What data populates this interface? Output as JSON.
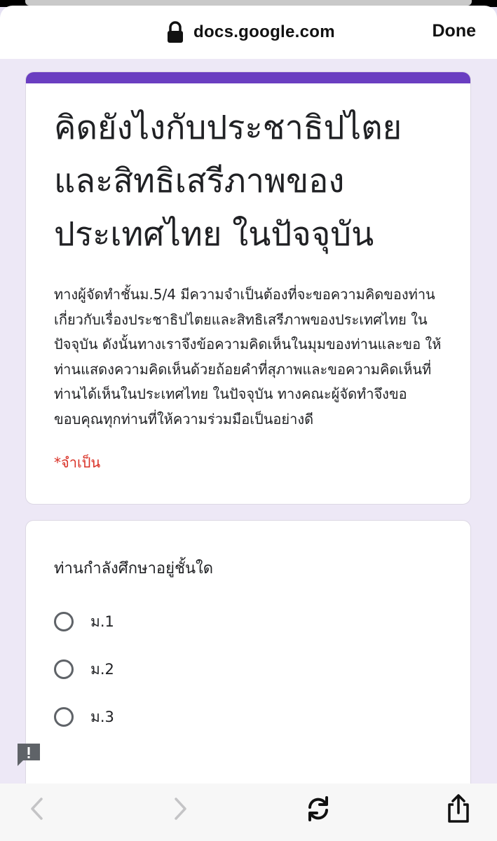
{
  "browser": {
    "url": "docs.google.com",
    "done_label": "Done",
    "secure_icon": "lock-icon"
  },
  "form": {
    "accent_color": "#6a3ec1",
    "title": "คิดยังไงกับประชาธิปไตยและสิทธิเสรีภาพของประเทศไทย ในปัจจุบัน",
    "description": "ทางผู้จัดทำชั้นม.5/4 มีความจำเป็นต้องที่จะขอความคิดของท่าน เกี่ยวกับเรื่องประชาธิปไตยและสิทธิเสรีภาพของประเทศไทย ในปัจจุบัน ดังนั้นทางเราจึงข้อความคิดเห็นในมุมของท่านและขอ ให้ท่านแสดงความคิดเห็นด้วยถ้อยคำที่สุภาพและขอความคิดเห็นที่ท่านได้เห็นในประเทศไทย ในปัจจุบัน ทางคณะผู้จัดทำจึงขอขอบคุณทุกท่านที่ให้ความร่วมมือเป็นอย่างดี",
    "required_note": "*จำเป็น"
  },
  "question": {
    "title": "ท่านกำลังศึกษาอยู่ชั้นใด",
    "options": [
      "ม.1",
      "ม.2",
      "ม.3"
    ]
  },
  "toolbar": {
    "icons": [
      "back-icon",
      "forward-icon",
      "reload-icon",
      "share-icon"
    ]
  }
}
